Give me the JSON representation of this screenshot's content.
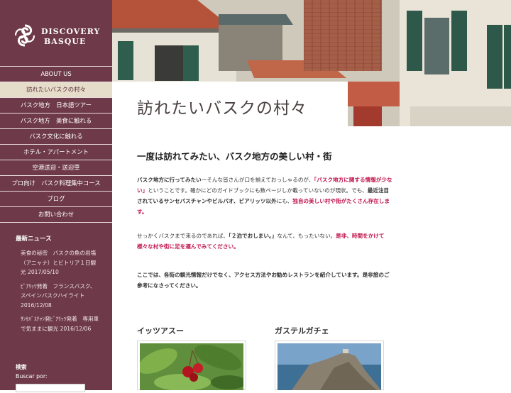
{
  "brand": {
    "line1": "DISCOVERY",
    "line2": "BASQUE"
  },
  "nav": [
    "ABOUT US",
    "訪れたいバスクの村々",
    "バスク地方　日本語ツアー",
    "バスク地方　美食に触れる",
    "バスク文化に触れる",
    "ホテル・アパートメント",
    "空港送迎・送迎車",
    "プロ向け　バスク料理集中コース",
    "ブログ",
    "お問い合わせ"
  ],
  "news": {
    "title": "最新ニュース",
    "items": [
      "美食の秘密　バスクの魚の岩塩（アニャナ）とビトリア１日観光 2017/05/10",
      "ﾋﾟｱﾘｯﾂ発着　フランスバスク、スペインバスクハイライト 2016/12/08",
      "ｻﾝｾﾊﾞｽﾁｬﾝ発ﾋﾞｱﾘｯﾂ発着　専用車で気ままに観光 2016/12/06"
    ]
  },
  "search": {
    "title": "検索",
    "label": "Buscar por:"
  },
  "page": {
    "title": "訪れたいバスクの村々",
    "subtitle": "一度は訪れてみたい、バスク地方の美しい村・街",
    "p1": {
      "a": "バスク地方に行ってみたい",
      "b": "ーそんな皆さんが口を揃えておっしゃるのが、",
      "c": "「バスク地方に関する情報が少ない」",
      "d": "ということです。確かにどのガイドブックにも数ページしか載っていないのが現状。でも、",
      "e": "最近注目されているサンセバスチャンやビルバオ、ビアリッツ以外",
      "f": "にも、",
      "g": "独自の美しい村や街がたくさん存在します。"
    },
    "p2": {
      "a": "せっかくバスクまで来るのであれば、",
      "b": "「２泊でおしまい。」",
      "c": "なんて、もったいない。",
      "d": "是非、時間をかけて様々な村や街に足を運んでみてください。"
    },
    "p3": "ここでは、各街の観光情報だけでなく、アクセス方法やお勧めレストランを紹介しています。是非旅のご参考になさってください。",
    "cards": [
      "イッツアスー",
      "ガステルガチェ"
    ]
  },
  "colors": {
    "sidebar": "#6e3a4a",
    "active_nav": "#e5ddc9",
    "accent": "#c0154c"
  }
}
